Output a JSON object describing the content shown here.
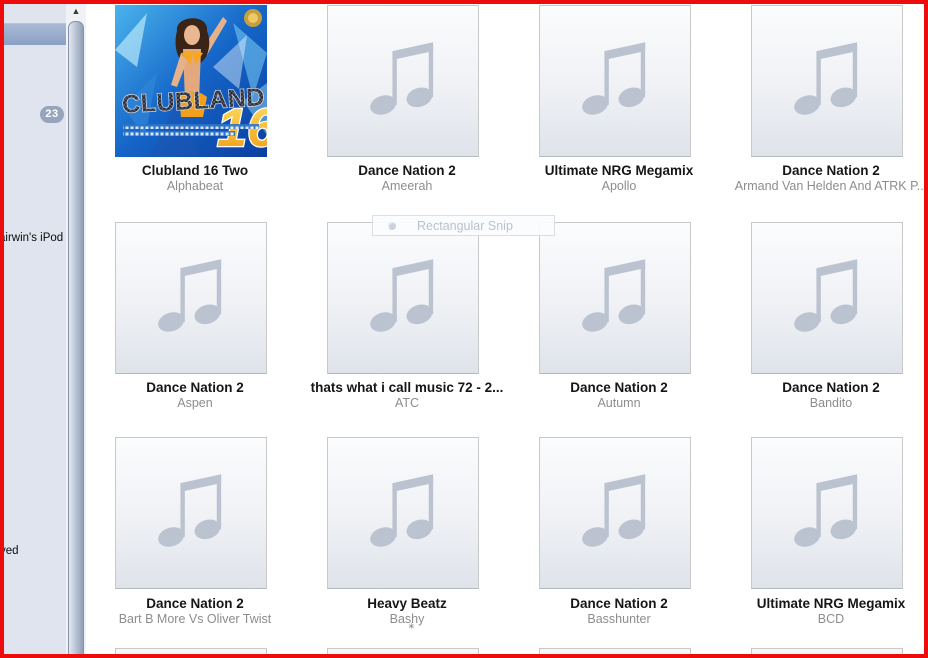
{
  "frame": {
    "border_color": "#ed0b0b"
  },
  "sidebar": {
    "badge_count": "23",
    "partial_items": [
      {
        "label": "airwin's iPod"
      },
      {
        "label": "yed"
      }
    ]
  },
  "scrollbar": {
    "up_arrow": "▲"
  },
  "snip_overlay": {
    "tooltip_label": "Rectangular Snip",
    "cursor_mark": "✳"
  },
  "grid": {
    "placeholder_icon": "music-note",
    "albums": [
      {
        "title": "Clubland 16 Two",
        "artist": "Alphabeat",
        "has_artwork": true,
        "artwork_logo": "CLUBLAND",
        "artwork_number": "16"
      },
      {
        "title": "Dance Nation 2",
        "artist": "Ameerah"
      },
      {
        "title": "Ultimate NRG Megamix",
        "artist": "Apollo"
      },
      {
        "title": "Dance Nation 2",
        "artist": "Armand Van Helden And ATRK P..."
      },
      {
        "title": "Dance Nation 2",
        "artist": "Aspen"
      },
      {
        "title": "thats what i call music 72 - 2...",
        "artist": "ATC"
      },
      {
        "title": "Dance Nation 2",
        "artist": "Autumn"
      },
      {
        "title": "Dance Nation 2",
        "artist": "Bandito"
      },
      {
        "title": "Dance Nation 2",
        "artist": "Bart B More Vs Oliver Twist"
      },
      {
        "title": "Heavy Beatz",
        "artist": "Bashy"
      },
      {
        "title": "Dance Nation 2",
        "artist": "Basshunter"
      },
      {
        "title": "Ultimate NRG Megamix",
        "artist": "BCD"
      }
    ]
  }
}
